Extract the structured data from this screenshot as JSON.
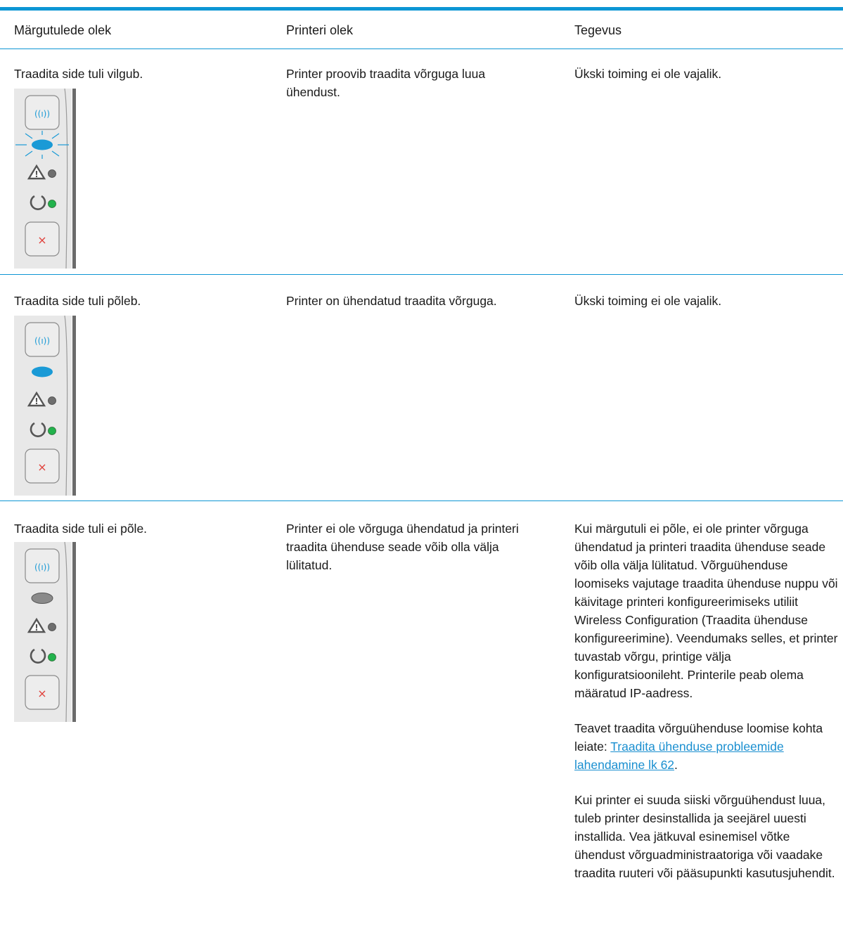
{
  "header": {
    "caption_fragment": "",
    "col1": "Märgutulede olek",
    "col2": "Printeri olek",
    "col3": "Tegevus"
  },
  "rows": [
    {
      "light_state": "Traadita side tuli vilgub.",
      "printer_state": "Printer proovib traadita võrguga luua ühendust.",
      "action_paragraphs": [
        "Ükski toiming ei ole vajalik."
      ],
      "wireless_led": "blinking"
    },
    {
      "light_state": "Traadita side tuli põleb.",
      "printer_state": "Printer on ühendatud traadita võrguga.",
      "action_paragraphs": [
        "Ükski toiming ei ole vajalik."
      ],
      "wireless_led": "on"
    },
    {
      "light_state": "Traadita side tuli ei põle.",
      "printer_state": "Printer ei ole võrguga ühendatud ja printeri traadita ühenduse seade võib olla välja lülitatud.",
      "action_paragraphs": [
        "Kui märgutuli ei põle, ei ole printer võrguga ühendatud ja printeri traadita ühenduse seade võib olla välja lülitatud. Võrguühenduse loomiseks vajutage traadita ühenduse nuppu või käivitage printeri konfigureerimiseks utiliit Wireless Configuration (Traadita ühenduse konfigureerimine). Veendumaks selles, et printer tuvastab võrgu, printige välja konfiguratsioonileht. Printerile peab olema määratud IP-aadress.",
        "Kui printer ei suuda siiski võrguühendust luua, tuleb printer desinstallida ja seejärel uuesti installida. Vea jätkuval esinemisel võtke ühendust võrguadministraatoriga või vaadake traadita ruuteri või pääsupunkti kasutusjuhendit."
      ],
      "link_intro": "Teavet traadita võrguühenduse loomise kohta leiate: ",
      "link_text": "Traadita ühenduse probleemide lahendamine lk 62",
      "link_suffix": ".",
      "wireless_led": "off"
    }
  ],
  "colors": {
    "accent": "#0d96d4",
    "wireless_led_on": "#1a9ad6",
    "wireless_led_off": "#8a8a8a",
    "ready_led": "#22b24c",
    "attention_led": "#6e6e6e",
    "cancel_x": "#e0403a",
    "link": "#1a8fd0"
  },
  "icons": {
    "wireless_button": "wireless-icon",
    "attention": "warning-triangle-icon",
    "ready": "power-ring-icon",
    "cancel": "cancel-x-icon"
  }
}
